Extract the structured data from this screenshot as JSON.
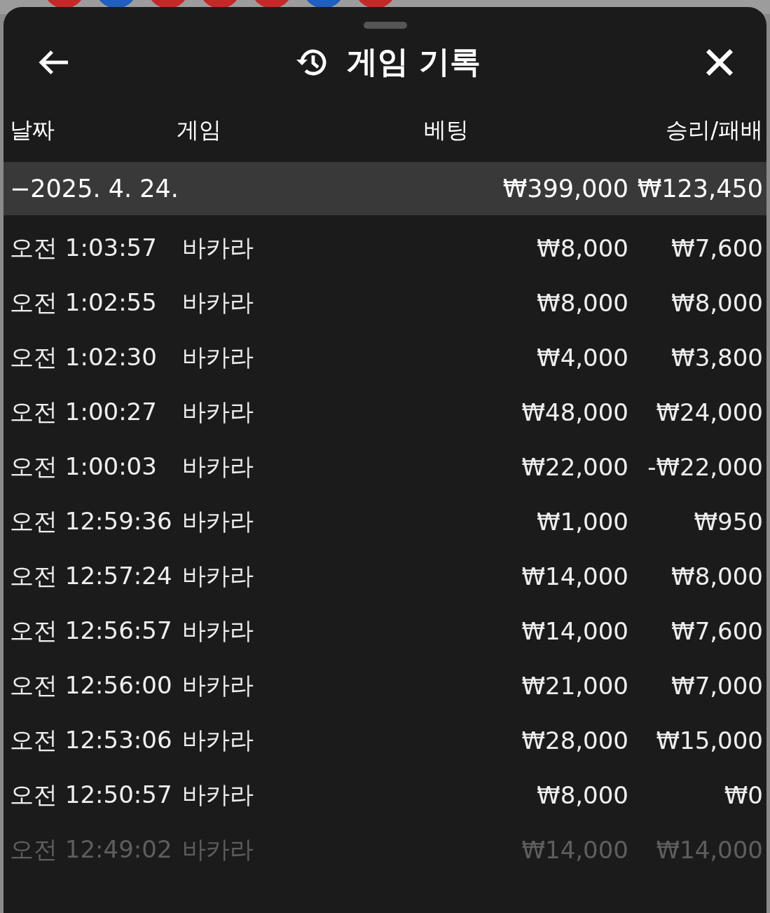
{
  "backdrop": {
    "beads": [
      {
        "color": "#c62828"
      },
      {
        "color": "#1e5fbf"
      },
      {
        "color": "#c62828"
      },
      {
        "color": "#c62828"
      },
      {
        "color": "#c62828"
      },
      {
        "color": "#1e5fbf"
      },
      {
        "color": "#c62828"
      }
    ]
  },
  "header": {
    "title": "게임 기록"
  },
  "columns": [
    "날짜",
    "게임",
    "베팅",
    "승리/패배"
  ],
  "date_group": {
    "date": "−2025. 4. 24.",
    "bet_total": "₩399,000",
    "result_total": "₩123,450"
  },
  "rows": [
    {
      "time": "오전 1:03:57",
      "game": "바카라",
      "bet": "₩8,000",
      "result": "₩7,600",
      "faded": false
    },
    {
      "time": "오전 1:02:55",
      "game": "바카라",
      "bet": "₩8,000",
      "result": "₩8,000",
      "faded": false
    },
    {
      "time": "오전 1:02:30",
      "game": "바카라",
      "bet": "₩4,000",
      "result": "₩3,800",
      "faded": false
    },
    {
      "time": "오전 1:00:27",
      "game": "바카라",
      "bet": "₩48,000",
      "result": "₩24,000",
      "faded": false
    },
    {
      "time": "오전 1:00:03",
      "game": "바카라",
      "bet": "₩22,000",
      "result": "-₩22,000",
      "faded": false
    },
    {
      "time": "오전 12:59:36",
      "game": "바카라",
      "bet": "₩1,000",
      "result": "₩950",
      "faded": false
    },
    {
      "time": "오전 12:57:24",
      "game": "바카라",
      "bet": "₩14,000",
      "result": "₩8,000",
      "faded": false
    },
    {
      "time": "오전 12:56:57",
      "game": "바카라",
      "bet": "₩14,000",
      "result": "₩7,600",
      "faded": false
    },
    {
      "time": "오전 12:56:00",
      "game": "바카라",
      "bet": "₩21,000",
      "result": "₩7,000",
      "faded": false
    },
    {
      "time": "오전 12:53:06",
      "game": "바카라",
      "bet": "₩28,000",
      "result": "₩15,000",
      "faded": false
    },
    {
      "time": "오전 12:50:57",
      "game": "바카라",
      "bet": "₩8,000",
      "result": "₩0",
      "faded": false
    },
    {
      "time": "오전 12:49:02",
      "game": "바카라",
      "bet": "₩14,000",
      "result": "₩14,000",
      "faded": true
    }
  ]
}
